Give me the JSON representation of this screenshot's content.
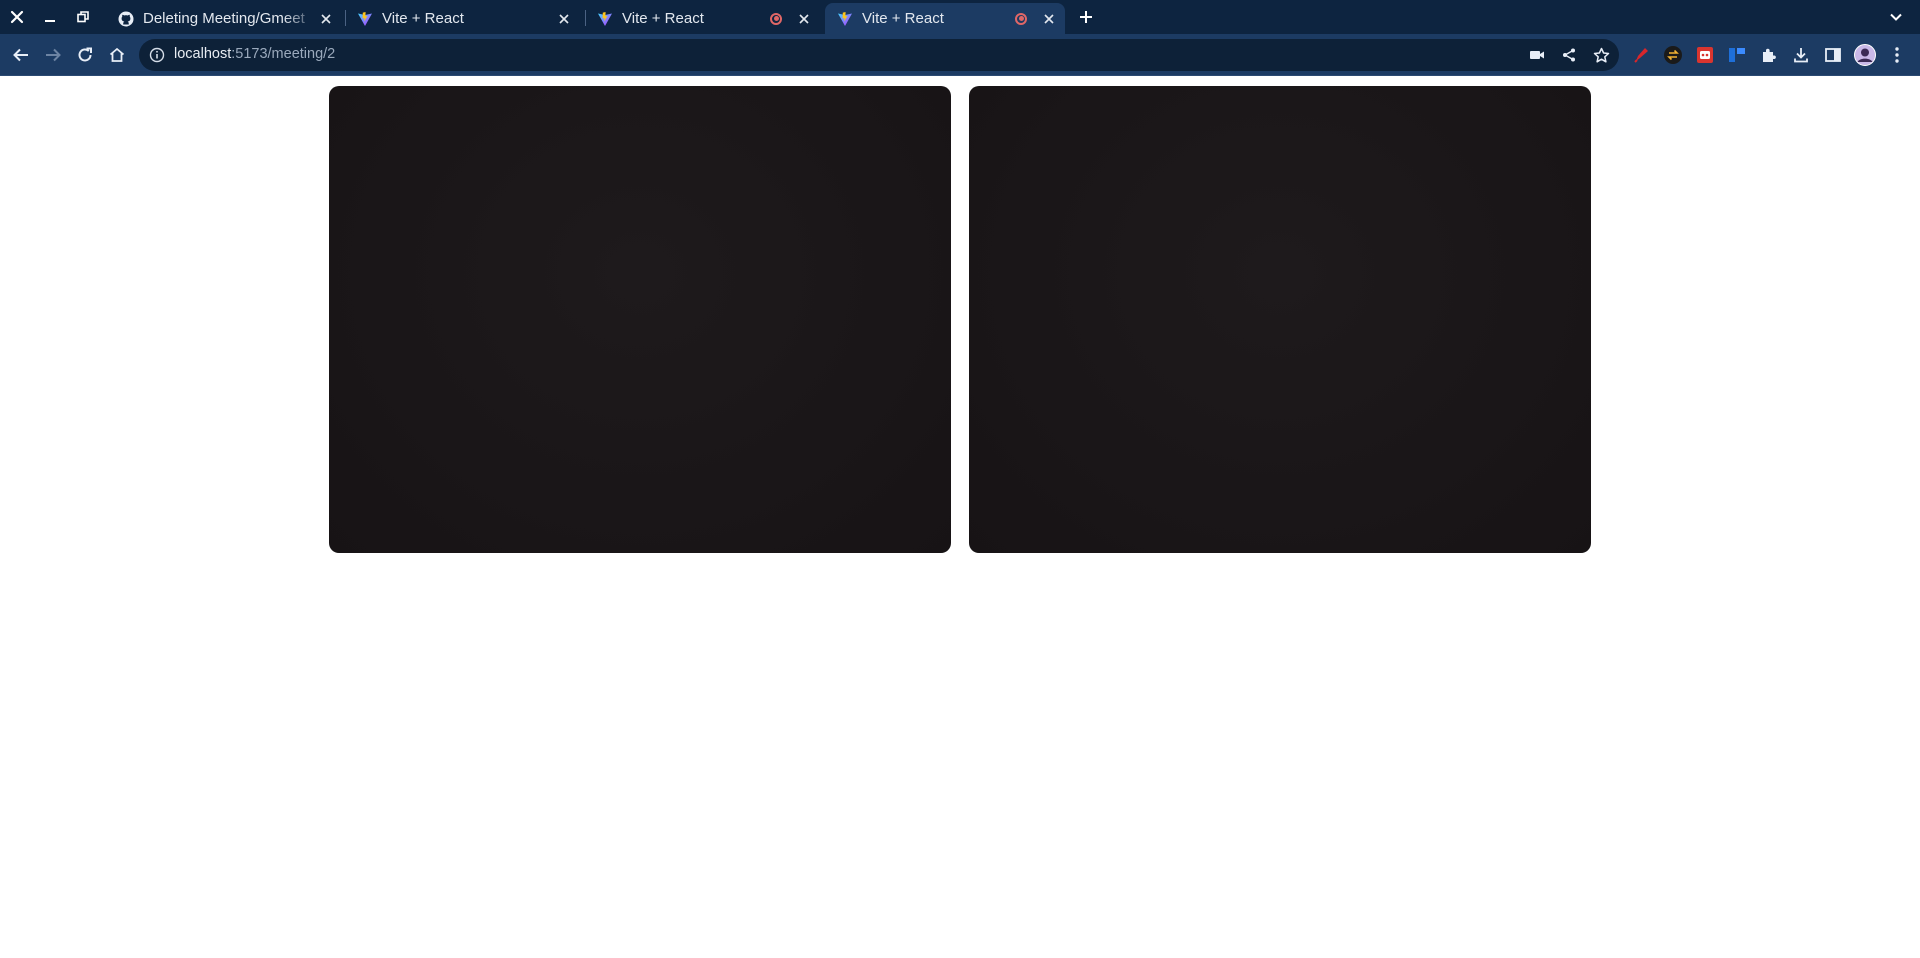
{
  "window_controls": [
    "close-icon",
    "minimize-icon",
    "restore-icon"
  ],
  "tabs": [
    {
      "title": "Deleting Meeting/Gmeet",
      "favicon": "github-icon",
      "recording": false,
      "active": false
    },
    {
      "title": "Vite + React",
      "favicon": "vite-icon",
      "recording": false,
      "active": false
    },
    {
      "title": "Vite + React",
      "favicon": "vite-icon",
      "recording": true,
      "active": false
    },
    {
      "title": "Vite + React",
      "favicon": "vite-icon",
      "recording": true,
      "active": true
    }
  ],
  "address_bar": {
    "host": "localhost",
    "path": ":5173/meeting/2"
  },
  "toolbar_icons": [
    "back-icon",
    "forward-icon",
    "reload-icon",
    "home-icon"
  ],
  "omnibox_icons": [
    "camera-icon",
    "share-icon",
    "bookmark-star-icon"
  ],
  "extensions": [
    "red-pen-extension-icon",
    "dark-arrows-extension-icon",
    "red-robot-extension-icon",
    "blue-board-extension-icon",
    "puzzle-icon",
    "download-icon",
    "side-panel-icon",
    "profile-avatar",
    "menu-kebab-icon"
  ],
  "videos": [
    {
      "name": "local-video"
    },
    {
      "name": "remote-video"
    }
  ],
  "colors": {
    "tabstrip": "#0d2440",
    "toolbar": "#1c3b63",
    "video_bg": "#1a1618"
  }
}
